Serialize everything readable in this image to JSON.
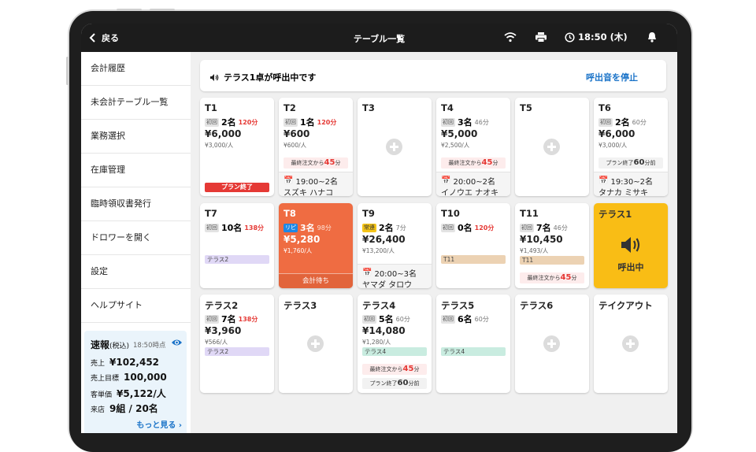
{
  "topbar": {
    "back_label": "戻る",
    "title": "テーブル一覧",
    "time": "18:50 (木)"
  },
  "sidebar": {
    "items": [
      {
        "label": "会計履歴"
      },
      {
        "label": "未会計テーブル一覧"
      },
      {
        "label": "業務選択"
      },
      {
        "label": "在庫管理"
      },
      {
        "label": "臨時領収書発行"
      },
      {
        "label": "ドロワーを開く"
      },
      {
        "label": "設定"
      },
      {
        "label": "ヘルプサイト"
      }
    ],
    "stats": {
      "title": "速報",
      "title_note": "(税込)",
      "time": "18:50時点",
      "sales_label": "売上",
      "sales": "¥102,452",
      "target_label": "売上目標",
      "target": "100,000",
      "avg_label": "客単価",
      "avg": "¥5,122/人",
      "visits_label": "来店",
      "visits": "9組 / 20名",
      "more": "もっと見る"
    }
  },
  "call_banner": {
    "message": "テラス1卓が呼出中です",
    "stop_label": "呼出音を停止"
  },
  "tables": {
    "t1": {
      "name": "T1",
      "tag": "初回",
      "guests": "2名",
      "elapsed": "120分",
      "total": "¥6,000",
      "per": "¥3,000/人",
      "end": "プラン終了"
    },
    "t2": {
      "name": "T2",
      "tag": "初回",
      "guests": "1名",
      "elapsed": "120分",
      "total": "¥600",
      "per": "¥600/人",
      "note_pre": "最終注文から",
      "note_val": "45",
      "note_post": "分",
      "resv_time": "19:00~2名",
      "resv_name": "スズキ ハナコ"
    },
    "t3": {
      "name": "T3"
    },
    "t4": {
      "name": "T4",
      "tag": "初回",
      "guests": "3名",
      "elapsed": "46分",
      "total": "¥5,000",
      "per": "¥2,500/人",
      "note_pre": "最終注文から",
      "note_val": "45",
      "note_post": "分",
      "resv_time": "20:00~2名",
      "resv_name": "イノウエ ナオキ"
    },
    "t5": {
      "name": "T5"
    },
    "t6": {
      "name": "T6",
      "tag": "初回",
      "guests": "2名",
      "elapsed": "60分",
      "total": "¥6,000",
      "per": "¥3,000/人",
      "note_pre": "プラン終了",
      "note_val": "60",
      "note_post": "分前",
      "resv_time": "19:30~2名",
      "resv_name": "タナカ ミサキ"
    },
    "t7": {
      "name": "T7",
      "tag": "初回",
      "guests": "10名",
      "elapsed": "138分",
      "pill": "テラス2"
    },
    "t8": {
      "name": "T8",
      "tag": "リピ",
      "guests": "3名",
      "elapsed": "98分",
      "total": "¥5,280",
      "per": "¥1,760/人",
      "wait": "会計待ち"
    },
    "t9": {
      "name": "T9",
      "tag": "常連",
      "guests": "2名",
      "elapsed": "7分",
      "total": "¥26,400",
      "per": "¥13,200/人",
      "resv_time": "20:00~3名",
      "resv_name": "ヤマダ タロウ"
    },
    "t10": {
      "name": "T10",
      "tag": "初回",
      "guests": "0名",
      "elapsed": "120分",
      "pill": "T11"
    },
    "t11": {
      "name": "T11",
      "tag": "初回",
      "guests": "7名",
      "elapsed": "46分",
      "total": "¥10,450",
      "per": "¥1,493/人",
      "pill": "T11",
      "note_pre": "最終注文から",
      "note_val": "45",
      "note_post": "分"
    },
    "terrace1": {
      "name": "テラス1",
      "status": "呼出中"
    },
    "terrace2": {
      "name": "テラス2",
      "tag": "初回",
      "guests": "7名",
      "elapsed": "138分",
      "total": "¥3,960",
      "per": "¥566/人",
      "pill": "テラス2"
    },
    "terrace3": {
      "name": "テラス3"
    },
    "terrace4": {
      "name": "テラス4",
      "tag": "初回",
      "guests": "5名",
      "elapsed": "60分",
      "total": "¥14,080",
      "per": "¥1,280/人",
      "pill": "テラス4",
      "note_pre": "最終注文から",
      "note_val": "45",
      "note_post": "分",
      "note2_pre": "プラン終了",
      "note2_val": "60",
      "note2_post": "分前"
    },
    "terrace5": {
      "name": "テラス5",
      "tag": "初回",
      "guests": "6名",
      "elapsed": "60分",
      "pill": "テラス4"
    },
    "terrace6": {
      "name": "テラス6"
    },
    "takeout": {
      "name": "テイクアウト"
    }
  },
  "colors": {
    "accent_blue": "#1a73c8",
    "alert_red": "#e53935",
    "waiting_orange": "#ef6c42",
    "calling_yellow": "#f9bd15"
  }
}
